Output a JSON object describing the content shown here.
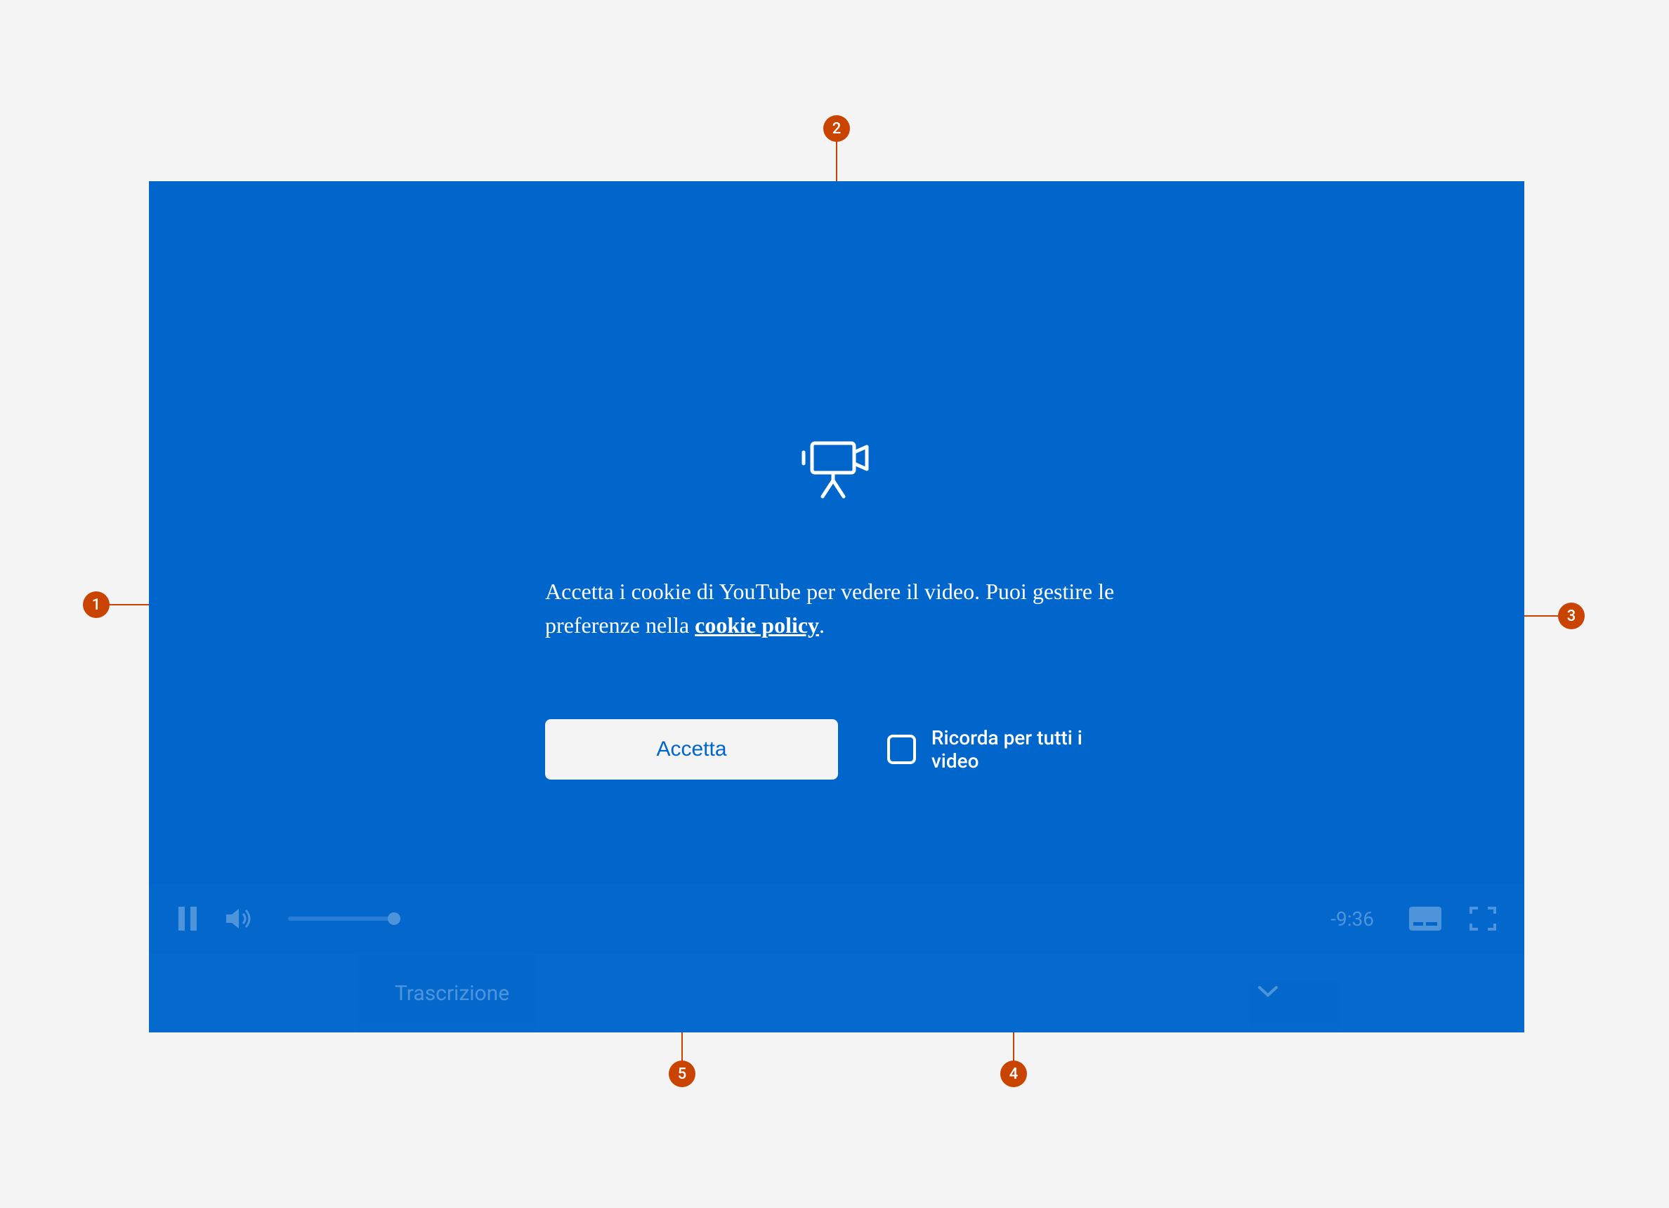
{
  "annotations": {
    "badge1": "1",
    "badge2": "2",
    "badge3": "3",
    "badge4": "4",
    "badge5": "5"
  },
  "cookie": {
    "message_prefix": "Accetta i cookie di YouTube per vedere il video. Puoi gestire le preferenze nella ",
    "link_text": "cookie policy",
    "message_suffix": ".",
    "accept_button": "Accetta",
    "remember_label": "Ricorda per tutti i video"
  },
  "controls": {
    "time_remaining": "-9:36",
    "transcript_label": "Trascrizione"
  }
}
